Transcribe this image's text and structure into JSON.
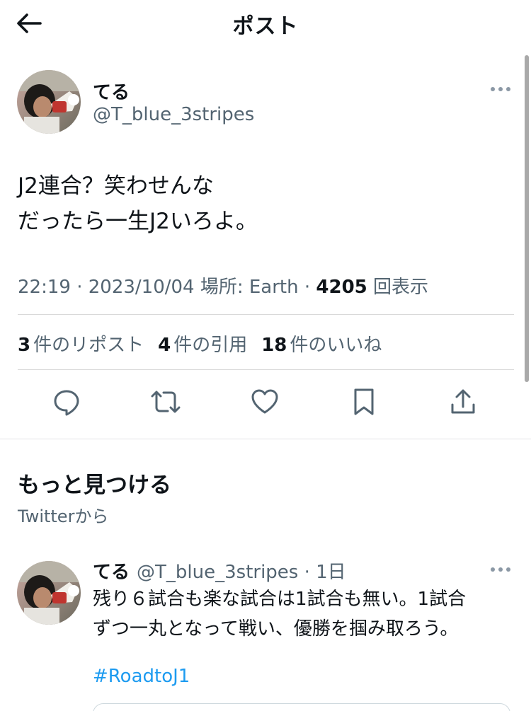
{
  "header": {
    "title": "ポスト",
    "back_icon": "arrow-left-icon"
  },
  "tweet": {
    "author_name": "てる",
    "author_handle": "@T_blue_3stripes",
    "lines": [
      "J2連合？笑わせんな",
      "だったら一生J2いろよ。"
    ],
    "meta": {
      "time": "22:19",
      "date": "2023/10/04",
      "location": "場所: Earth",
      "views_count": "4205",
      "views_label": "回表示"
    },
    "stats": {
      "reposts_count": "3",
      "reposts_label": "件のリポスト",
      "quotes_count": "4",
      "quotes_label": "件の引用",
      "likes_count": "18",
      "likes_label": "件のいいね"
    },
    "actions": [
      "reply-icon",
      "retweet-icon",
      "heart-icon",
      "bookmark-icon",
      "share-icon"
    ]
  },
  "discover": {
    "title": "もっと見つける",
    "subtitle": "Twitterから"
  },
  "recommended": {
    "author_name": "てる",
    "author_handle": "@T_blue_3stripes",
    "time": "1日",
    "lines": [
      "残り６試合も楽な試合は1試合も無い。1試合",
      "ずつ一丸となって戦い、優勝を掴み取ろう。"
    ],
    "hashtag": "#RoadtoJ1"
  },
  "colors": {
    "text": "#0f1419",
    "muted": "#536471",
    "link": "#1d9bf0",
    "divider": "#d9d9d9"
  }
}
